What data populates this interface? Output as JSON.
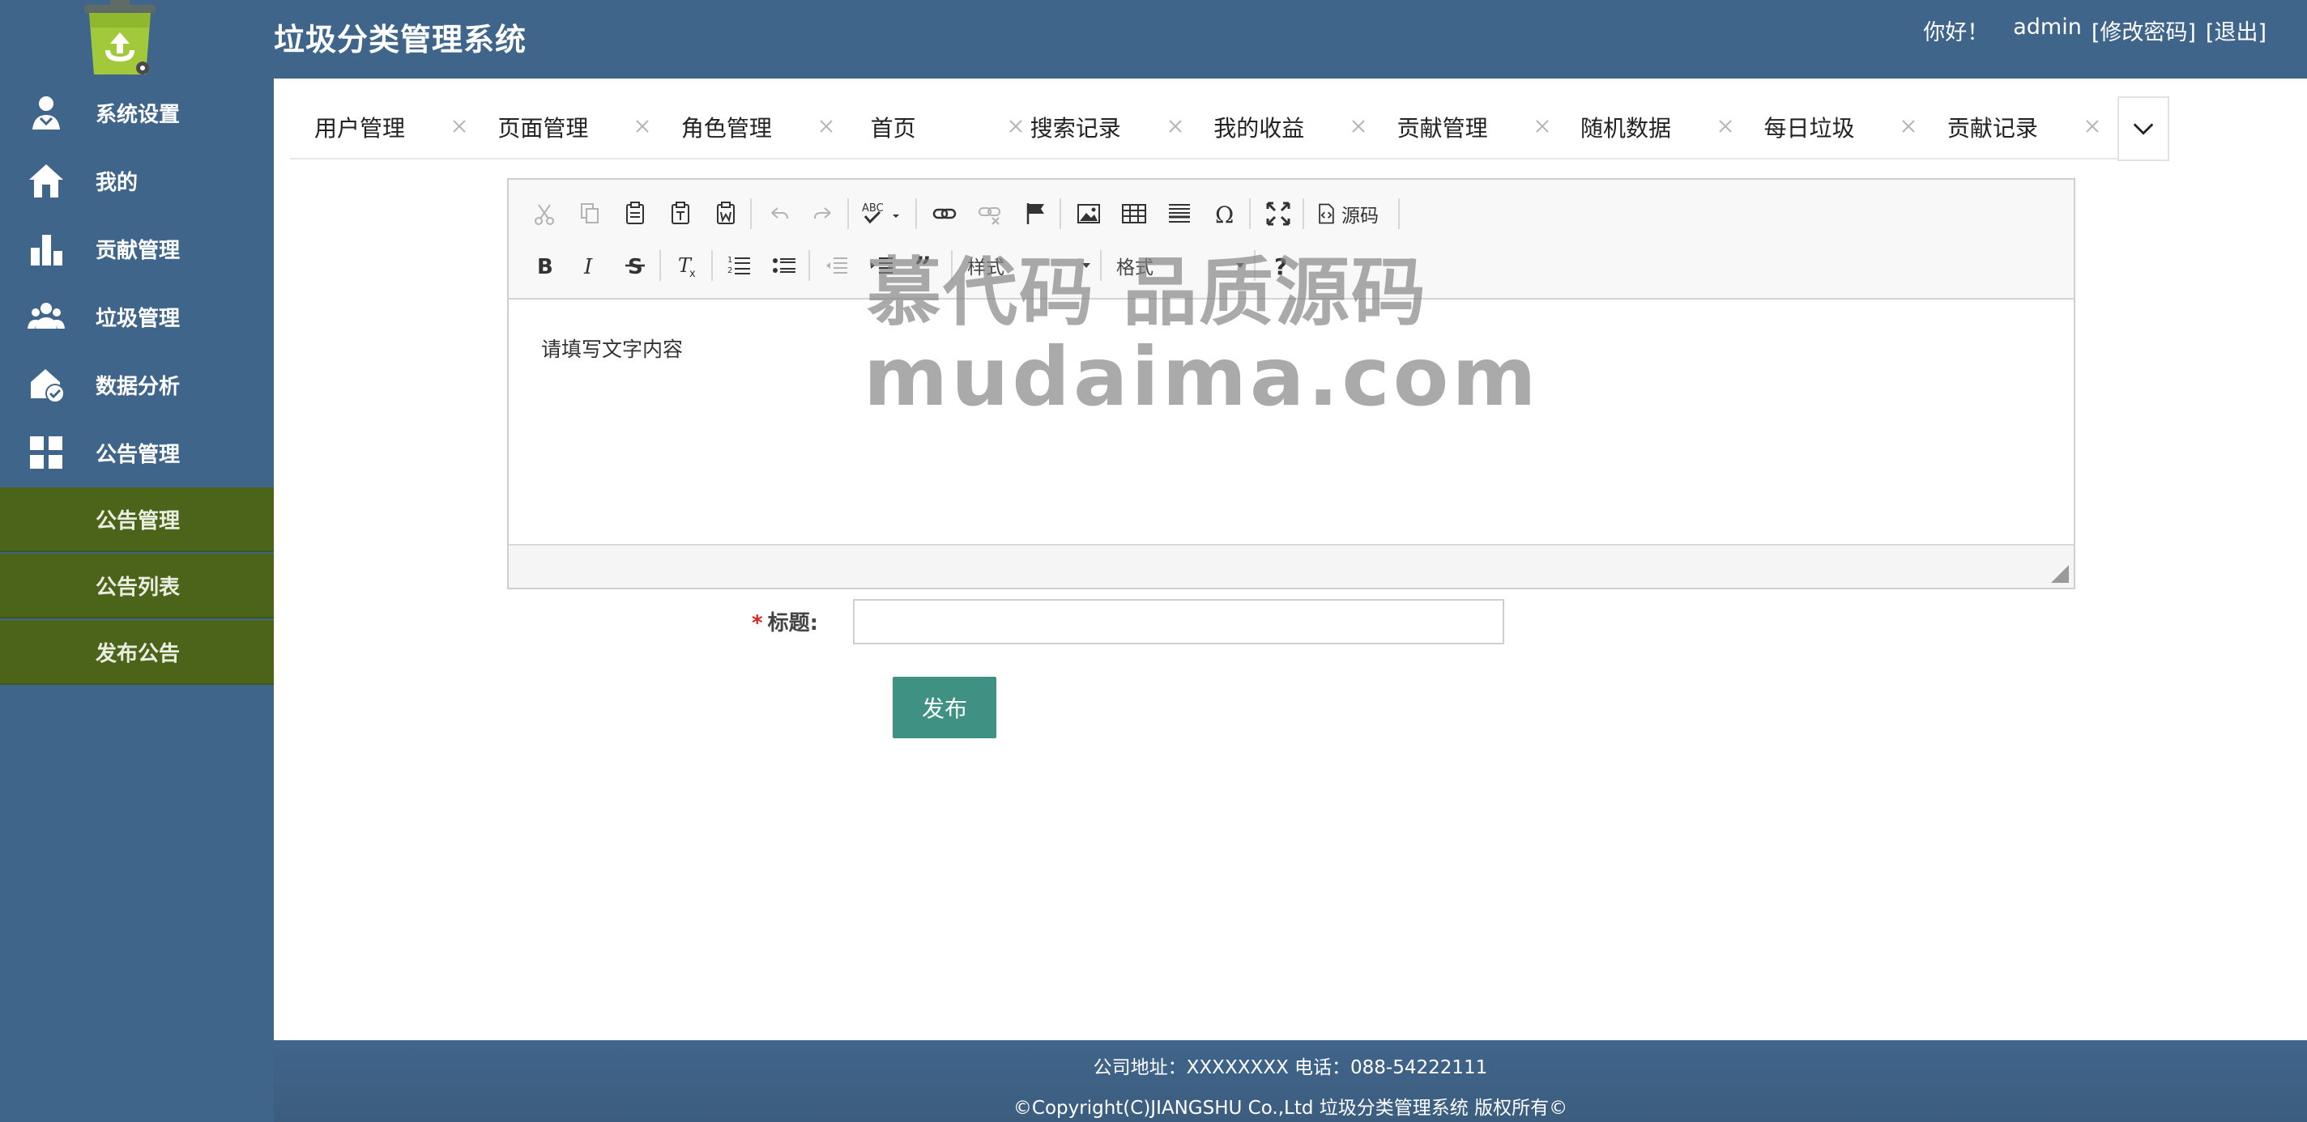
{
  "header": {
    "app_title": "垃圾分类管理系统",
    "greeting": "你好！",
    "username": "admin",
    "change_password": "[修改密码]",
    "logout": "[退出]"
  },
  "sidebar": {
    "items": [
      {
        "label": "系统设置",
        "icon": "user-settings-icon"
      },
      {
        "label": "我的",
        "icon": "home-icon"
      },
      {
        "label": "贡献管理",
        "icon": "bar-chart-icon"
      },
      {
        "label": "垃圾管理",
        "icon": "group-icon"
      },
      {
        "label": "数据分析",
        "icon": "house-check-icon"
      },
      {
        "label": "公告管理",
        "icon": "grid-icon"
      }
    ],
    "sub_items": [
      {
        "label": "公告管理"
      },
      {
        "label": "公告列表"
      },
      {
        "label": "发布公告"
      }
    ]
  },
  "tabs": [
    {
      "label": "用户管理"
    },
    {
      "label": "页面管理"
    },
    {
      "label": "角色管理"
    },
    {
      "label": "首页"
    },
    {
      "label": "搜索记录"
    },
    {
      "label": "我的收益"
    },
    {
      "label": "贡献管理"
    },
    {
      "label": "随机数据"
    },
    {
      "label": "每日垃圾"
    },
    {
      "label": "贡献记录"
    }
  ],
  "editor": {
    "source_label": "源码",
    "styles_label": "样式",
    "format_label": "格式",
    "placeholder_text": "请填写文字内容"
  },
  "watermark": {
    "line1": "慕代码 品质源码",
    "line2": "mudaima.com"
  },
  "form": {
    "required_mark": "*",
    "title_label": "标题:",
    "title_value": "",
    "publish_label": "发布"
  },
  "footer": {
    "line1": "公司地址：XXXXXXXX 电话：088-54222111",
    "line2": "©Copyright(C)JIANGSHU Co.,Ltd 垃圾分类管理系统 版权所有©"
  },
  "colors": {
    "sidebar_bg": "#40658b",
    "submenu_bg": "#4b6419",
    "primary_button": "#3f9283",
    "required": "#e02020"
  }
}
